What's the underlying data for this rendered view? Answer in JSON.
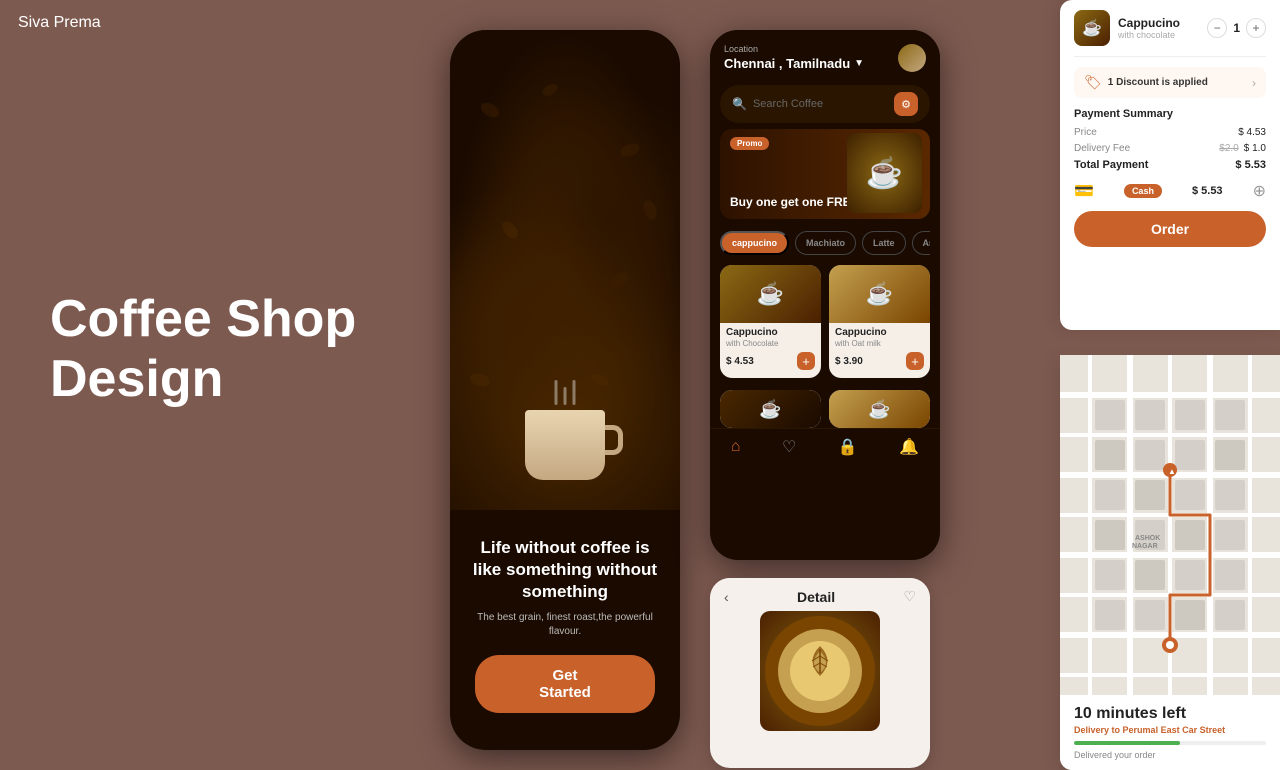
{
  "brand": "Siva Prema",
  "hero": {
    "line1": "Coffee Shop",
    "line2": "Design"
  },
  "phone1": {
    "tagline": "Life without coffee is like something without something",
    "sub": "The best grain, finest roast,the powerful flavour.",
    "cta": "Get Started"
  },
  "phone2": {
    "location_label": "Location",
    "location": "Chennai , Tamilnadu",
    "search_placeholder": "Search Coffee",
    "promo_badge": "Promo",
    "promo_text": "Buy one get one FREE",
    "categories": [
      "cappucino",
      "Machiato",
      "Latte",
      "Ameri"
    ],
    "active_category": "cappucino",
    "items": [
      {
        "name": "Cappucino",
        "sub": "with Chocolate",
        "price": "$ 4.53"
      },
      {
        "name": "Cappucino",
        "sub": "with Oat milk",
        "price": "$ 3.90"
      }
    ]
  },
  "phone3": {
    "title": "Detail"
  },
  "order_panel": {
    "item_name": "Cappucino",
    "item_sub": "with chocolate",
    "quantity": "1",
    "discount_text": "1 Discount is applied",
    "payment_summary_title": "Payment Summary",
    "price_label": "Price",
    "price_value": "$ 4.53",
    "delivery_label": "Delivery Fee",
    "delivery_original": "$2.0",
    "delivery_new": "$ 1.0",
    "total_label": "Total Payment",
    "total_value": "$ 5.53",
    "cash_label": "Cash",
    "cash_amount": "$ 5.53",
    "order_btn": "Order"
  },
  "map_panel": {
    "time_left": "10 minutes left",
    "delivery_text": "Delivery to",
    "delivery_location": "Perumal East Car Street",
    "progress_percent": 55,
    "delivered_label": "Delivered your order"
  }
}
